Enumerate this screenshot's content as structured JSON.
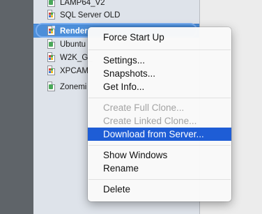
{
  "vm_list": [
    {
      "label": "LAMP64_V2",
      "os": "linux"
    },
    {
      "label": "SQL Server OLD",
      "os": "windows"
    },
    {
      "label": "Render",
      "os": "windows",
      "selected": true
    },
    {
      "label": "Ubuntu",
      "os": "linux"
    },
    {
      "label": "W2K_G_",
      "os": "windows"
    },
    {
      "label": "XPCAM",
      "os": "windows"
    },
    {
      "label": "Zonemi",
      "os": "linux"
    }
  ],
  "context_menu": {
    "force_start": "Force Start Up",
    "settings": "Settings...",
    "snapshots": "Snapshots...",
    "get_info": "Get Info...",
    "create_full_clone": "Create Full Clone...",
    "create_linked_clone": "Create Linked Clone...",
    "download_from_server": "Download from Server...",
    "show_windows": "Show Windows",
    "rename": "Rename",
    "delete": "Delete"
  }
}
